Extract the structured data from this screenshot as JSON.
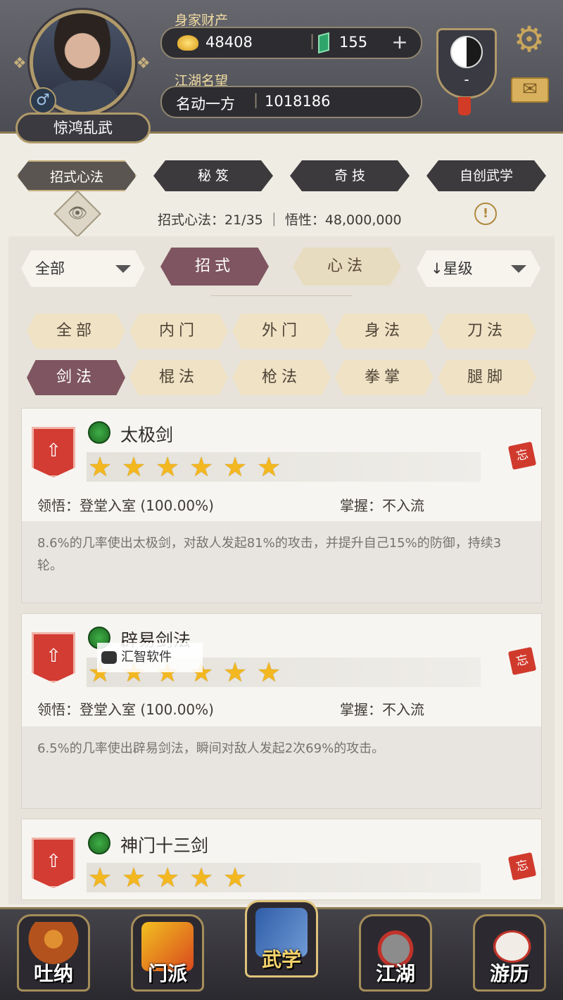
{
  "header": {
    "player_name": "惊鸿乱武",
    "gender_symbol": "♂",
    "wealth_label": "身家财产",
    "gold": "48408",
    "jade": "155",
    "plus_symbol": "+",
    "reputation_label": "江湖名望",
    "reputation_title": "名动一方",
    "reputation_value": "1018186",
    "emblem_value": "-",
    "mail_symbol": "✉",
    "gear_symbol": "⚙"
  },
  "tabs": [
    {
      "label": "招式心法"
    },
    {
      "label": "秘 笈"
    },
    {
      "label": "奇 技"
    },
    {
      "label": "自创武学"
    }
  ],
  "stats": {
    "text": "招式心法：21/35 ｜ 悟性：48,000,000",
    "eye_symbol": "👁",
    "warn_symbol": "!"
  },
  "filters": {
    "left_dropdown": "全部",
    "seg_left": "招式",
    "seg_right": "心法",
    "right_dropdown": "↓星级"
  },
  "chips": [
    {
      "label": "全部"
    },
    {
      "label": "内门"
    },
    {
      "label": "外门"
    },
    {
      "label": "身法"
    },
    {
      "label": "刀法"
    },
    {
      "label": "剑法"
    },
    {
      "label": "棍法"
    },
    {
      "label": "枪法"
    },
    {
      "label": "拳掌"
    },
    {
      "label": "腿脚"
    }
  ],
  "skills": [
    {
      "name": "太极剑",
      "stars": 6,
      "comprehension": "领悟：登堂入室 (100.00%)",
      "mastery": "掌握：不入流",
      "forget": "忘",
      "description": "8.6%的几率使出太极剑，对敌人发起81%的攻击，并提升自己15%的防御，持续3轮。"
    },
    {
      "name": "辟易剑法",
      "stars": 6,
      "comprehension": "领悟：登堂入室 (100.00%)",
      "mastery": "掌握：不入流",
      "forget": "忘",
      "description": "6.5%的几率使出辟易剑法，瞬间对敌人发起2次69%的攻击。"
    },
    {
      "name": "神门十三剑",
      "stars": 5,
      "forget": "忘"
    }
  ],
  "watermark": "汇智软件",
  "nav": [
    {
      "label": "吐纳",
      "icon": "monk-icon"
    },
    {
      "label": "门派",
      "icon": "banner-icon"
    },
    {
      "label": "武学",
      "icon": "book-icon"
    },
    {
      "label": "江湖",
      "icon": "hat-icon"
    },
    {
      "label": "游历",
      "icon": "horse-icon"
    }
  ],
  "colors": {
    "accent": "#7e5560",
    "gold_text": "#f0dca0",
    "star": "#f3b71f",
    "rank_red": "#d23c33"
  }
}
